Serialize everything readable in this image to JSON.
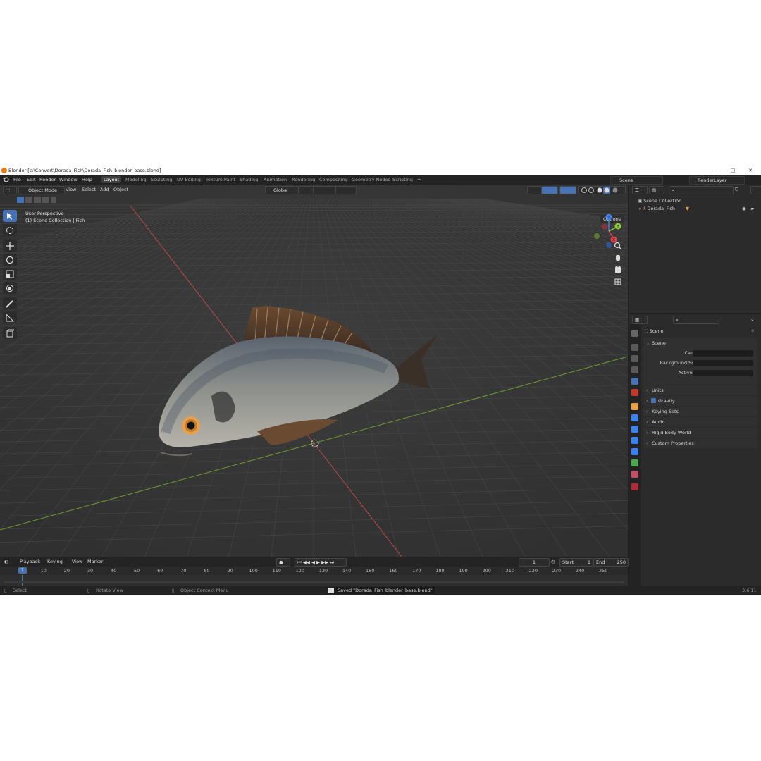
{
  "window": {
    "title": "Blender [c:\\Convert\\Dorada_Fish\\Dorada_Fish_blender_base.blend]",
    "controls": [
      "–",
      "□",
      "✕"
    ]
  },
  "menu": [
    "File",
    "Edit",
    "Render",
    "Window",
    "Help"
  ],
  "workspaces": [
    {
      "label": "Layout",
      "active": true
    },
    {
      "label": "Modeling"
    },
    {
      "label": "Sculpting"
    },
    {
      "label": "UV Editing"
    },
    {
      "label": "Texture Paint"
    },
    {
      "label": "Shading"
    },
    {
      "label": "Animation"
    },
    {
      "label": "Rendering"
    },
    {
      "label": "Compositing"
    },
    {
      "label": "Geometry Nodes"
    },
    {
      "label": "Scripting"
    }
  ],
  "add_workspace": "+",
  "scene_selector": "Scene",
  "view_layer_selector": "RenderLayer",
  "viewport": {
    "mode": "Object Mode",
    "menus": [
      "View",
      "Select",
      "Add",
      "Object"
    ],
    "transform_orientation": "Global",
    "perspective_label": "User Perspective",
    "collection_label": "(1) Scene Collection | Fish",
    "options_label": "Options"
  },
  "gizmo_axes": {
    "x": "X",
    "y": "Y",
    "z": "Z"
  },
  "timeline": {
    "menus": [
      "Playback",
      "Keying",
      "View",
      "Marker"
    ],
    "current_frame": "1",
    "start_label": "Start",
    "start_value": "1",
    "end_label": "End",
    "end_value": "250",
    "ruler_current": "1",
    "ruler_ticks": [
      "10",
      "20",
      "30",
      "40",
      "50",
      "60",
      "70",
      "80",
      "90",
      "100",
      "110",
      "120",
      "130",
      "140",
      "150",
      "160",
      "170",
      "180",
      "190",
      "200",
      "210",
      "220",
      "230",
      "240",
      "250"
    ]
  },
  "outliner": {
    "root": "Scene Collection",
    "items": [
      {
        "label": "Dorada_Fish"
      }
    ]
  },
  "properties": {
    "header": "Scene",
    "panel_title": "Scene",
    "fields": {
      "camera_label": "Camera",
      "background_label": "Background Scene",
      "clip_label": "Active Clip"
    },
    "panels": [
      "Units",
      "Gravity",
      "Keying Sets",
      "Audio",
      "Rigid Body World",
      "Custom Properties"
    ]
  },
  "statusbar": {
    "select": "Select",
    "rotate": "Rotate View",
    "context": "Object Context Menu",
    "message": "Saved \"Dorada_Fish_blender_base.blend\"",
    "version": "3.6.11"
  },
  "colors": {
    "accent": "#4772b3",
    "x_axis": "#e0434f",
    "y_axis": "#8ccb3a",
    "z_axis": "#3e82f0",
    "bg": "#393939"
  }
}
